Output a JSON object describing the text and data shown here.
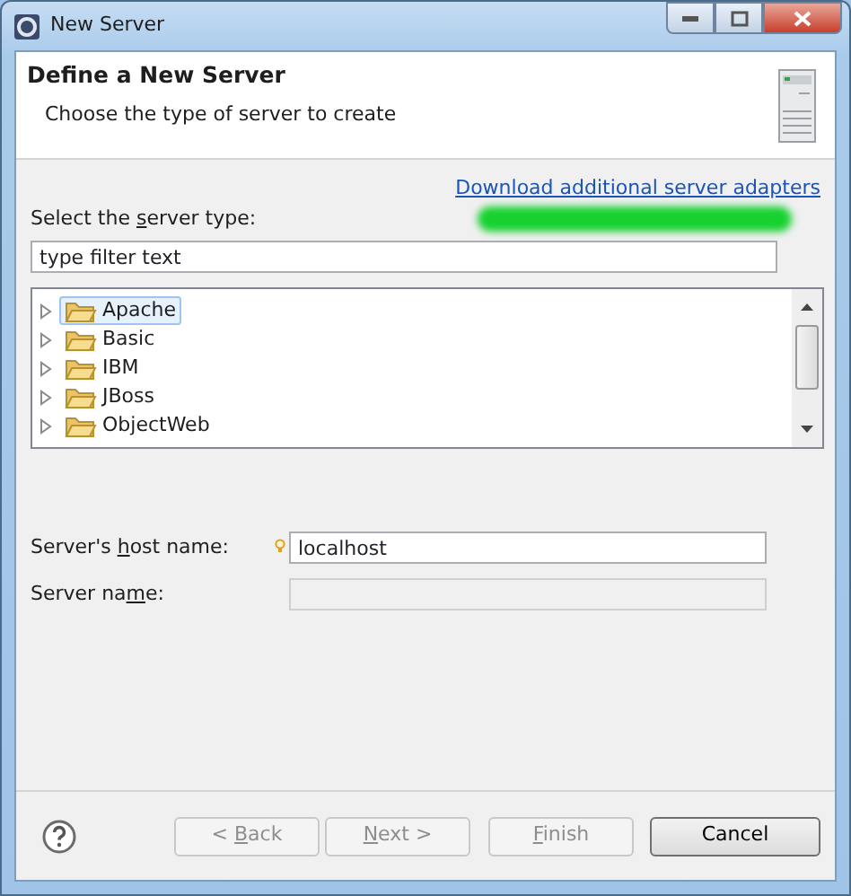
{
  "window": {
    "title": "New Server"
  },
  "header": {
    "title": "Define a New Server",
    "subtitle": "Choose the type of server to create"
  },
  "download_link": "Download additional server adapters",
  "server_type_label": {
    "before": "Select the ",
    "key": "s",
    "after": "erver type:"
  },
  "filter": {
    "value": "type filter text"
  },
  "tree": [
    {
      "label": "Apache",
      "selected": true,
      "expanded": false
    },
    {
      "label": "Basic",
      "selected": false,
      "expanded": false
    },
    {
      "label": "IBM",
      "selected": false,
      "expanded": false
    },
    {
      "label": "JBoss",
      "selected": false,
      "expanded": false
    },
    {
      "label": "ObjectWeb",
      "selected": false,
      "expanded": false
    }
  ],
  "fields": [
    {
      "label": {
        "before": "Server's ",
        "key": "h",
        "after": "ost name:"
      },
      "value": "localhost",
      "disabled": false,
      "hint": true
    },
    {
      "label": {
        "before": "Server na",
        "key": "m",
        "after": "e:"
      },
      "disabled": true,
      "hint": false
    }
  ],
  "buttons": [
    {
      "before": "< ",
      "key": "B",
      "after": "ack",
      "disabled": true,
      "kind": "nav"
    },
    {
      "key": "N",
      "after": "ext >",
      "disabled": true,
      "kind": "nav"
    },
    {
      "key": "F",
      "after": "inish",
      "disabled": true,
      "kind": "finish"
    },
    {
      "after": "Cancel",
      "disabled": false,
      "kind": "cancel"
    }
  ]
}
